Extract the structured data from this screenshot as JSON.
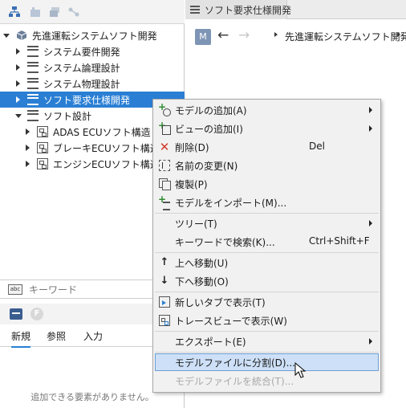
{
  "model_tree": {
    "toolbar_icons": [
      "model-tree-icon",
      "add-view-icon",
      "layers-icon",
      "connect-icon"
    ],
    "nodes": [
      {
        "label": "先進運転システムソフト開発",
        "icon": "cube-icon",
        "expander": "open"
      },
      {
        "label": "システム要件開発",
        "icon": "list-icon",
        "expander": "closed"
      },
      {
        "label": "システム論理設計",
        "icon": "list-icon",
        "expander": "closed"
      },
      {
        "label": "システム物理設計",
        "icon": "list-icon",
        "expander": "closed"
      },
      {
        "label": "ソフト要求仕様開発",
        "icon": "list-icon",
        "expander": "closed",
        "selected": true
      },
      {
        "label": "ソフト設計",
        "icon": "list-icon",
        "expander": "open"
      },
      {
        "label": "ADAS ECUソフト構造",
        "icon": "structure-icon",
        "expander": "closed"
      },
      {
        "label": "ブレーキECUソフト構造",
        "icon": "structure-icon",
        "expander": "closed"
      },
      {
        "label": "エンジンECUソフト構造",
        "icon": "structure-icon",
        "expander": "closed"
      }
    ]
  },
  "keyword_search": {
    "icon_text": "abc",
    "placeholder": "キーワード"
  },
  "palette": {
    "icon2_letter": "F",
    "tabs": [
      "新規",
      "参照",
      "入力"
    ],
    "active_tab": "新規",
    "empty_message": "追加できる要素がありません。"
  },
  "editor": {
    "tab_label": "ソフト要求仕様開発",
    "badge": "M",
    "breadcrumb": "先進運転システムソフト開発"
  },
  "context_menu": {
    "items": [
      {
        "label": "モデルの追加(A)",
        "icon": "add-model-icon",
        "submenu": true
      },
      {
        "label": "ビューの追加(I)",
        "icon": "add-view-icon",
        "submenu": true
      },
      {
        "label": "削除(D)",
        "icon": "delete-icon",
        "shortcut": "Del"
      },
      {
        "label": "名前の変更(N)",
        "icon": "rename-icon"
      },
      {
        "label": "複製(P)",
        "icon": "duplicate-icon"
      },
      {
        "label": "モデルをインポート(M)...",
        "icon": "import-model-icon"
      },
      {
        "label": "ツリー(T)",
        "submenu": true
      },
      {
        "label": "キーワードで検索(K)...",
        "shortcut": "Ctrl+Shift+F"
      },
      {
        "label": "上へ移動(U)",
        "icon": "move-up-icon"
      },
      {
        "label": "下へ移動(O)",
        "icon": "move-down-icon"
      },
      {
        "label": "新しいタブで表示(T)",
        "icon": "new-tab-icon"
      },
      {
        "label": "トレースビューで表示(W)",
        "icon": "trace-view-icon"
      },
      {
        "label": "エクスポート(E)",
        "submenu": true
      },
      {
        "label": "モデルファイルに分割(D)...",
        "highlighted": true
      },
      {
        "label": "モデルファイルを統合(T)...",
        "disabled": true
      }
    ]
  },
  "colors": {
    "selection": "#2a7fd4",
    "menu_highlight": "#cde0f7",
    "delete_red": "#d23a2a",
    "add_green": "#2e8b2e"
  }
}
